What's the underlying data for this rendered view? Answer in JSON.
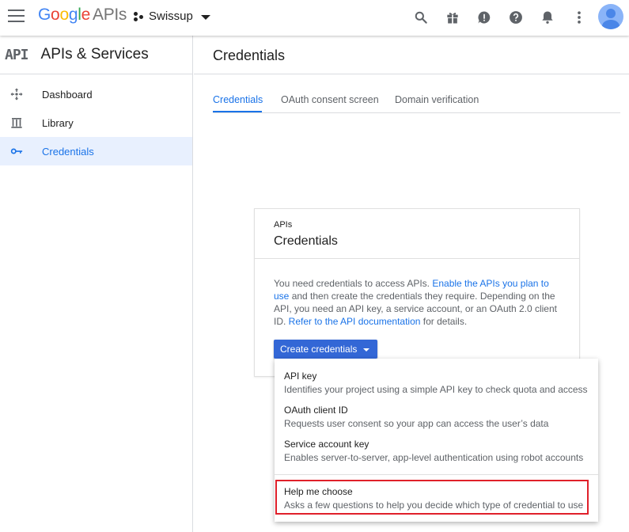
{
  "header": {
    "logo": {
      "g1": "G",
      "g2": "o",
      "g3": "o",
      "g4": "g",
      "g5": "l",
      "g6": "e",
      "apis": "APIs"
    },
    "project": "Swissup",
    "icons": [
      "search-icon",
      "gift-icon",
      "feedback-icon",
      "help-icon",
      "notifications-icon",
      "more-vert-icon",
      "account-avatar"
    ]
  },
  "sidebar": {
    "api_badge": "API",
    "title": "APIs & Services",
    "items": [
      {
        "label": "Dashboard",
        "icon": "dashboard-icon",
        "active": false
      },
      {
        "label": "Library",
        "icon": "library-icon",
        "active": false
      },
      {
        "label": "Credentials",
        "icon": "key-icon",
        "active": true
      }
    ]
  },
  "main": {
    "title": "Credentials",
    "tabs": [
      {
        "label": "Credentials",
        "active": true
      },
      {
        "label": "OAuth consent screen",
        "active": false
      },
      {
        "label": "Domain verification",
        "active": false
      }
    ]
  },
  "card": {
    "eyebrow": "APIs",
    "title": "Credentials",
    "text_1": "You need credentials to access APIs. ",
    "link_1": "Enable the APIs you plan to use",
    "text_2": " and then create the credentials they require. Depending on the API, you need an API key, a service account, or an OAuth 2.0 client ID. ",
    "link_2": "Refer to the API documentation",
    "text_3": " for details.",
    "button": "Create credentials"
  },
  "menu": {
    "items": [
      {
        "title": "API key",
        "desc": "Identifies your project using a simple API key to check quota and access"
      },
      {
        "title": "OAuth client ID",
        "desc": "Requests user consent so your app can access the user’s data"
      },
      {
        "title": "Service account key",
        "desc": "Enables server-to-server, app-level authentication using robot accounts"
      },
      {
        "title": "Help me choose",
        "desc": "Asks a few questions to help you decide which type of credential to use"
      }
    ]
  },
  "colors": {
    "accent": "#1a73e8",
    "button": "#3367d6",
    "highlight_border": "#e0202a",
    "active_bg": "#e8f0fe"
  }
}
